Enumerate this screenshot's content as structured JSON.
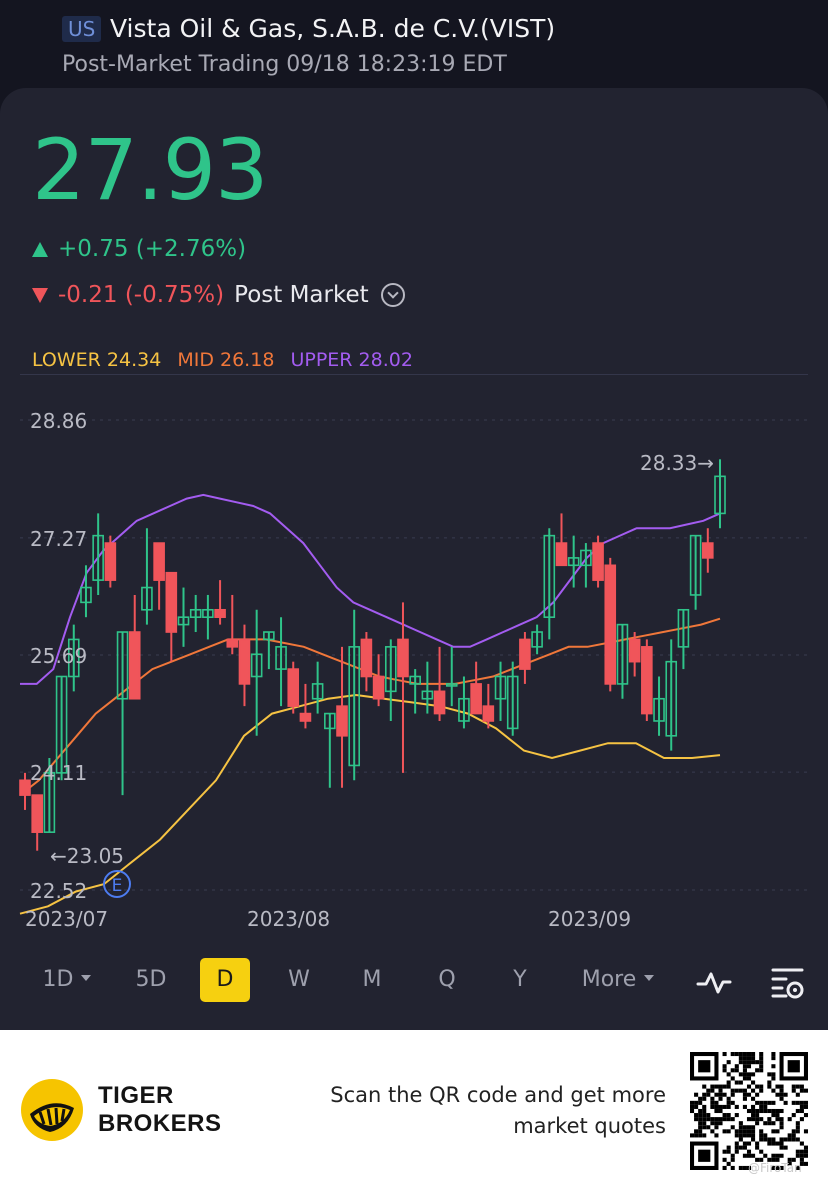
{
  "header": {
    "market_badge": "US",
    "title": "Vista Oil & Gas, S.A.B. de C.V.(VIST)",
    "session_status": "Post-Market Trading 09/18 18:23:19 EDT"
  },
  "quote": {
    "last_price": "27.93",
    "day_change": "+0.75 (+2.76%)",
    "post_change": "-0.21 (-0.75%)",
    "post_market_label": "Post Market"
  },
  "bollinger": {
    "lower_label": "LOWER 24.34",
    "mid_label": "MID 26.18",
    "upper_label": "UPPER 28.02",
    "lower_color": "#f6c343",
    "mid_color": "#f0773a",
    "upper_color": "#a35cf0"
  },
  "colors": {
    "up": "#2fc48a",
    "down": "#f0555a",
    "accent": "#f6d010",
    "panel_bg": "#222330"
  },
  "chart_data": {
    "type": "candlestick",
    "y_tick_labels": [
      "28.86",
      "27.27",
      "25.69",
      "24.11",
      "22.52"
    ],
    "x_tick_labels": [
      "2023/07",
      "2023/08",
      "2023/09"
    ],
    "ylim": [
      22.52,
      28.86
    ],
    "high_marker": "28.33",
    "low_marker": "23.05",
    "earnings_marker": "E",
    "candles": [
      [
        24.0,
        24.1,
        23.6,
        23.8
      ],
      [
        23.8,
        23.8,
        23.05,
        23.3
      ],
      [
        23.3,
        24.3,
        23.3,
        24.1
      ],
      [
        24.1,
        25.4,
        24.0,
        25.4
      ],
      [
        25.4,
        26.1,
        25.2,
        25.9
      ],
      [
        26.4,
        26.9,
        26.2,
        26.6
      ],
      [
        26.7,
        27.6,
        26.5,
        27.3
      ],
      [
        27.2,
        27.3,
        26.6,
        26.7
      ],
      [
        25.1,
        26.0,
        23.8,
        26.0
      ],
      [
        26.0,
        26.5,
        25.2,
        25.1
      ],
      [
        26.3,
        27.4,
        26.1,
        26.6
      ],
      [
        27.2,
        27.2,
        26.3,
        26.7
      ],
      [
        26.8,
        26.8,
        25.6,
        26.0
      ],
      [
        26.1,
        26.6,
        25.8,
        26.2
      ],
      [
        26.2,
        26.5,
        26.0,
        26.3
      ],
      [
        26.2,
        26.5,
        25.9,
        26.3
      ],
      [
        26.3,
        26.7,
        26.1,
        26.2
      ],
      [
        25.9,
        26.5,
        25.7,
        25.8
      ],
      [
        25.9,
        26.1,
        25.0,
        25.3
      ],
      [
        25.4,
        26.3,
        24.6,
        25.7
      ],
      [
        25.9,
        26.0,
        25.5,
        26.0
      ],
      [
        25.5,
        26.2,
        25.0,
        25.8
      ],
      [
        25.5,
        25.6,
        24.9,
        25.0
      ],
      [
        24.9,
        25.3,
        24.7,
        24.8
      ],
      [
        25.1,
        25.6,
        24.9,
        25.3
      ],
      [
        24.7,
        24.9,
        23.9,
        24.9
      ],
      [
        25.0,
        25.8,
        23.9,
        24.6
      ],
      [
        24.2,
        26.3,
        24.0,
        25.8
      ],
      [
        25.9,
        26.0,
        25.2,
        25.4
      ],
      [
        25.4,
        25.7,
        25.0,
        25.1
      ],
      [
        25.2,
        25.9,
        24.8,
        25.8
      ],
      [
        25.9,
        26.4,
        24.1,
        25.4
      ],
      [
        25.3,
        25.5,
        24.9,
        25.4
      ],
      [
        25.1,
        25.6,
        24.9,
        25.2
      ],
      [
        25.2,
        25.8,
        24.8,
        24.9
      ],
      [
        25.3,
        25.8,
        25.0,
        25.3
      ],
      [
        24.8,
        25.4,
        24.7,
        25.1
      ],
      [
        25.3,
        25.6,
        24.9,
        24.9
      ],
      [
        25.0,
        25.3,
        24.7,
        24.8
      ],
      [
        25.1,
        25.6,
        24.8,
        25.4
      ],
      [
        24.7,
        25.6,
        24.6,
        25.4
      ],
      [
        25.9,
        26.0,
        25.3,
        25.5
      ],
      [
        25.8,
        26.1,
        25.7,
        26.0
      ],
      [
        26.2,
        27.4,
        25.9,
        27.3
      ],
      [
        27.2,
        27.6,
        26.9,
        26.9
      ],
      [
        26.9,
        27.3,
        26.6,
        27.0
      ],
      [
        26.9,
        27.2,
        26.6,
        27.1
      ],
      [
        27.2,
        27.3,
        26.6,
        26.7
      ],
      [
        26.9,
        27.0,
        25.2,
        25.3
      ],
      [
        25.3,
        26.1,
        25.1,
        26.1
      ],
      [
        25.9,
        26.0,
        25.4,
        25.6
      ],
      [
        25.8,
        25.9,
        24.8,
        24.9
      ],
      [
        24.8,
        25.4,
        24.6,
        25.1
      ],
      [
        24.6,
        25.9,
        24.4,
        25.6
      ],
      [
        25.8,
        26.3,
        25.5,
        26.3
      ],
      [
        26.5,
        27.3,
        26.3,
        27.3
      ],
      [
        27.2,
        27.4,
        26.8,
        27.0
      ],
      [
        27.6,
        28.33,
        27.4,
        28.1
      ]
    ],
    "bollinger_upper": [
      25.3,
      25.3,
      25.5,
      26.2,
      26.8,
      27.1,
      27.3,
      27.5,
      27.6,
      27.7,
      27.8,
      27.85,
      27.8,
      27.75,
      27.7,
      27.6,
      27.4,
      27.2,
      26.9,
      26.6,
      26.4,
      26.3,
      26.2,
      26.1,
      26.0,
      25.9,
      25.8,
      25.8,
      25.9,
      26.0,
      26.1,
      26.2,
      26.4,
      26.7,
      27.0,
      27.2,
      27.3,
      27.4,
      27.4,
      27.4,
      27.45,
      27.5,
      27.6
    ],
    "bollinger_mid": [
      23.8,
      24.0,
      24.3,
      24.6,
      24.9,
      25.1,
      25.3,
      25.5,
      25.6,
      25.7,
      25.8,
      25.9,
      25.9,
      25.9,
      25.85,
      25.8,
      25.7,
      25.6,
      25.5,
      25.4,
      25.35,
      25.3,
      25.3,
      25.3,
      25.35,
      25.4,
      25.5,
      25.6,
      25.7,
      25.8,
      25.8,
      25.85,
      25.9,
      25.95,
      26.0,
      26.05,
      26.1,
      26.18
    ],
    "bollinger_lower": [
      22.2,
      22.3,
      22.5,
      22.6,
      22.9,
      23.2,
      23.6,
      24.0,
      24.6,
      24.9,
      25.0,
      25.1,
      25.15,
      25.1,
      25.05,
      25.0,
      24.9,
      24.7,
      24.4,
      24.3,
      24.4,
      24.5,
      24.5,
      24.3,
      24.3,
      24.34
    ]
  },
  "timeframes": [
    {
      "label": "1D",
      "dropdown": true
    },
    {
      "label": "5D"
    },
    {
      "label": "D",
      "active": true
    },
    {
      "label": "W"
    },
    {
      "label": "M"
    },
    {
      "label": "Q"
    },
    {
      "label": "Y"
    },
    {
      "label": "More",
      "dropdown": true
    }
  ],
  "toolbar_icons": [
    "indicator-icon",
    "chart-settings-icon"
  ],
  "footer": {
    "brand_line1": "TIGER",
    "brand_line2": "BROKERS",
    "qr_prompt_line1": "Scan the QR code and get more",
    "qr_prompt_line2": "market quotes",
    "watermark": "@FiroTan"
  }
}
